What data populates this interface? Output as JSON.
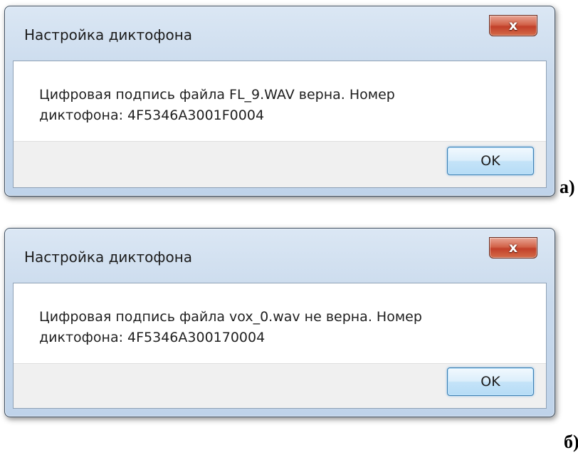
{
  "dialogs": [
    {
      "title": "Настройка диктофона",
      "close_glyph": "x",
      "message": "Цифровая подпись файла FL_9.WAV верна. Номер диктофона: 4F5346A3001F0004",
      "ok_label": "OK",
      "figure_label": "а)"
    },
    {
      "title": "Настройка диктофона",
      "close_glyph": "x",
      "message": "Цифровая подпись файла vox_0.wav не верна. Номер диктофона: 4F5346A300170004",
      "ok_label": "OK",
      "figure_label": "б)"
    }
  ],
  "icons": {
    "close": "close-icon"
  },
  "colors": {
    "close_button": "#c74a33",
    "ok_button_border": "#3c7fb1",
    "frame": "#bfd3ea"
  }
}
